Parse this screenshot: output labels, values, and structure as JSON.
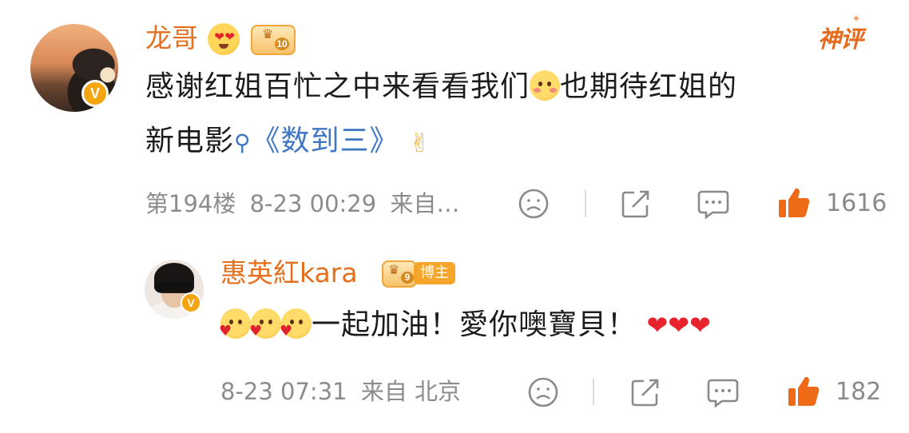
{
  "comments": [
    {
      "author": "龙哥",
      "level": "10",
      "content_text": "感谢红姐百忙之中来看看我们",
      "content_text2": "也期待红姐的",
      "content_text3": "新电影",
      "link_text": "《数到三》",
      "floor": "第194楼",
      "timestamp": "8-23 00:29",
      "source": "来自…",
      "like_count": "1616",
      "badge_label": "神评",
      "verified_mark": "V"
    }
  ],
  "replies": [
    {
      "author": "惠英紅kara",
      "level": "9",
      "tag": "博主",
      "content_text": "一起加油！愛你噢寶貝！",
      "timestamp": "8-23 07:31",
      "source": "来自 北京",
      "like_count": "182",
      "verified_mark": "V"
    }
  ],
  "icons": {
    "dislike": "sad-face-icon",
    "share": "share-icon",
    "comment": "comment-icon",
    "like": "thumbs-up-icon"
  },
  "colors": {
    "name": "#e46f1d",
    "link": "#3f77c4",
    "meta": "#8c8c8c",
    "like": "#ef6a17",
    "verified": "#f5a511"
  }
}
